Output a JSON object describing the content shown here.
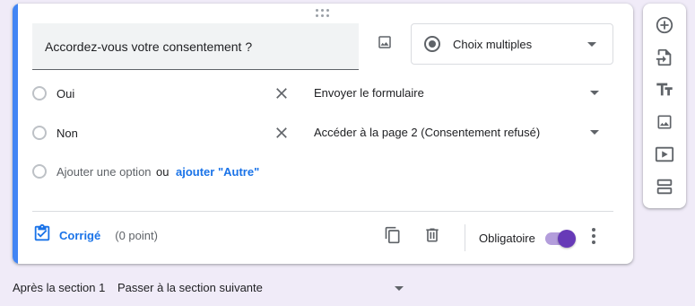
{
  "question": {
    "title": "Accordez-vous votre consentement ?",
    "type_label": "Choix multiples"
  },
  "options": [
    {
      "label": "Oui",
      "goto": "Envoyer le formulaire"
    },
    {
      "label": "Non",
      "goto": "Accéder à la page 2 (Consentement refusé)"
    }
  ],
  "add_option": {
    "add_label": "Ajouter une option",
    "or_label": "ou",
    "other_label": "ajouter \"Autre\""
  },
  "footer": {
    "answer_key_label": "Corrigé",
    "points_label": "(0 point)",
    "required_label": "Obligatoire",
    "required_on": true
  },
  "after_section": {
    "label": "Après la section 1",
    "value": "Passer à la section suivante"
  },
  "toolbar": [
    "add-question-icon",
    "import-questions-icon",
    "add-title-icon",
    "add-image-icon",
    "add-video-icon",
    "add-section-icon"
  ],
  "colors": {
    "background": "#f0ebf8",
    "accent": "#4285f4",
    "toggle": "#673ab7",
    "link": "#1a73e8"
  }
}
